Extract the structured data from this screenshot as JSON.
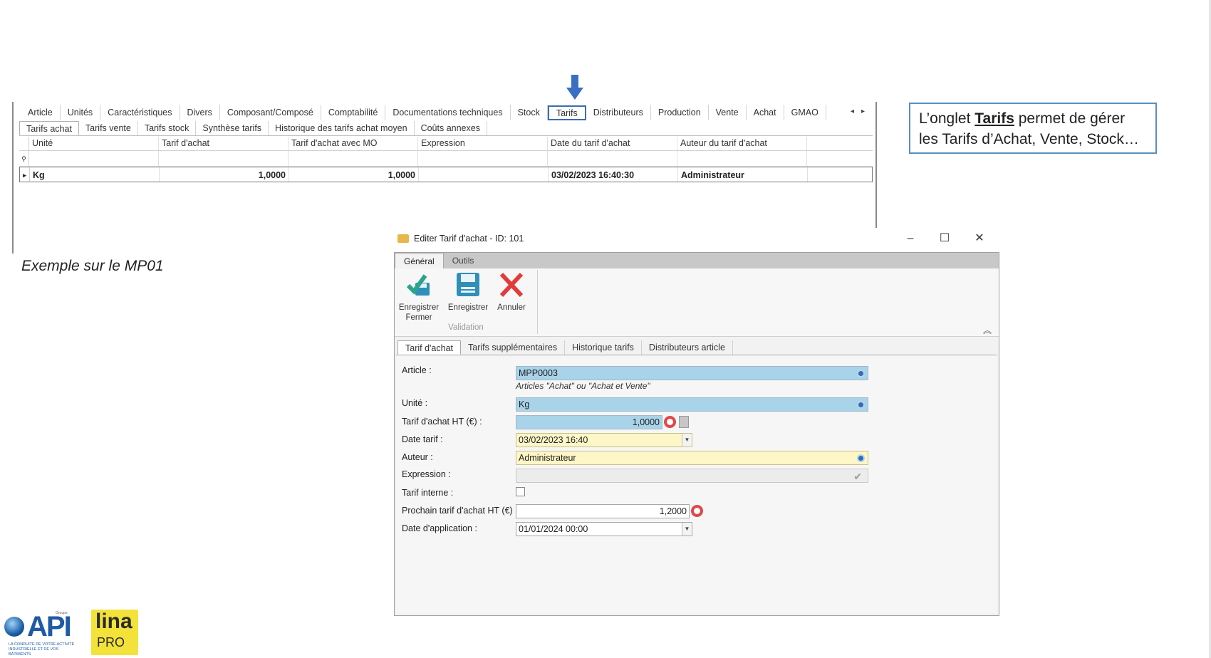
{
  "grid_panel": {
    "main_tabs": [
      "Article",
      "Unités",
      "Caractéristiques",
      "Divers",
      "Composant/Composé",
      "Comptabilité",
      "Documentations techniques",
      "Stock",
      "Tarifs",
      "Distributeurs",
      "Production",
      "Vente",
      "Achat",
      "GMAO"
    ],
    "active_main_tab": "Tarifs",
    "sub_tabs": [
      "Tarifs achat",
      "Tarifs vente",
      "Tarifs stock",
      "Synthèse tarifs",
      "Historique des tarifs achat moyen",
      "Coûts annexes"
    ],
    "active_sub_tab": "Tarifs achat",
    "columns": [
      "Unité",
      "Tarif d'achat",
      "Tarif d'achat avec MO",
      "Expression",
      "Date du tarif d'achat",
      "Auteur du tarif d'achat"
    ],
    "rows": [
      [
        "Kg",
        "1,0000",
        "1,0000",
        "",
        "03/02/2023 16:40:30",
        "Administrateur"
      ]
    ]
  },
  "callout": {
    "prefix": "L’onglet ",
    "bold": "Tarifs",
    "rest": " permet de gérer les Tarifs d’Achat, Vente, Stock…"
  },
  "caption": "Exemple sur le MP01",
  "dialog": {
    "title": "Editer Tarif d'achat - ID: 101",
    "ribbon_tabs": [
      "Général",
      "Outils"
    ],
    "buttons": {
      "save_close": "Enregistrer Fermer",
      "save": "Enregistrer",
      "cancel": "Annuler"
    },
    "group_label": "Validation",
    "form_tabs": [
      "Tarif d'achat",
      "Tarifs supplémentaires",
      "Historique tarifs",
      "Distributeurs article"
    ],
    "fields": {
      "article_label": "Article :",
      "article_value": "MPP0003",
      "article_hint": "Articles \"Achat\" ou \"Achat et Vente\"",
      "unite_label": "Unité :",
      "unite_value": "Kg",
      "tarif_label": "Tarif d'achat HT (€) :",
      "tarif_value": "1,0000",
      "date_label": "Date tarif :",
      "date_value": "03/02/2023 16:40",
      "auteur_label": "Auteur :",
      "auteur_value": "Administrateur",
      "expression_label": "Expression :",
      "expression_value": "",
      "interne_label": "Tarif interne :",
      "prochain_label": "Prochain tarif d'achat HT (€) :",
      "prochain_value": "1,2000",
      "application_label": "Date d'application :",
      "application_value": "01/01/2024 00:00"
    }
  },
  "logos": {
    "api": "API",
    "api_groupe": "Groupe",
    "api_tagline": "LA CONDUITE DE VOTRE ACTIVITÉ INDUSTRIELLE ET DE VOS BÂTIMENTS",
    "lina": "lina",
    "lina_pro": "PRO"
  },
  "colors": {
    "accent_blue": "#3a6db5",
    "field_blue": "#a9d3e8",
    "field_yellow": "#fdf6c6",
    "cancel_red": "#e23b3b",
    "save_green": "#2aa58b"
  }
}
